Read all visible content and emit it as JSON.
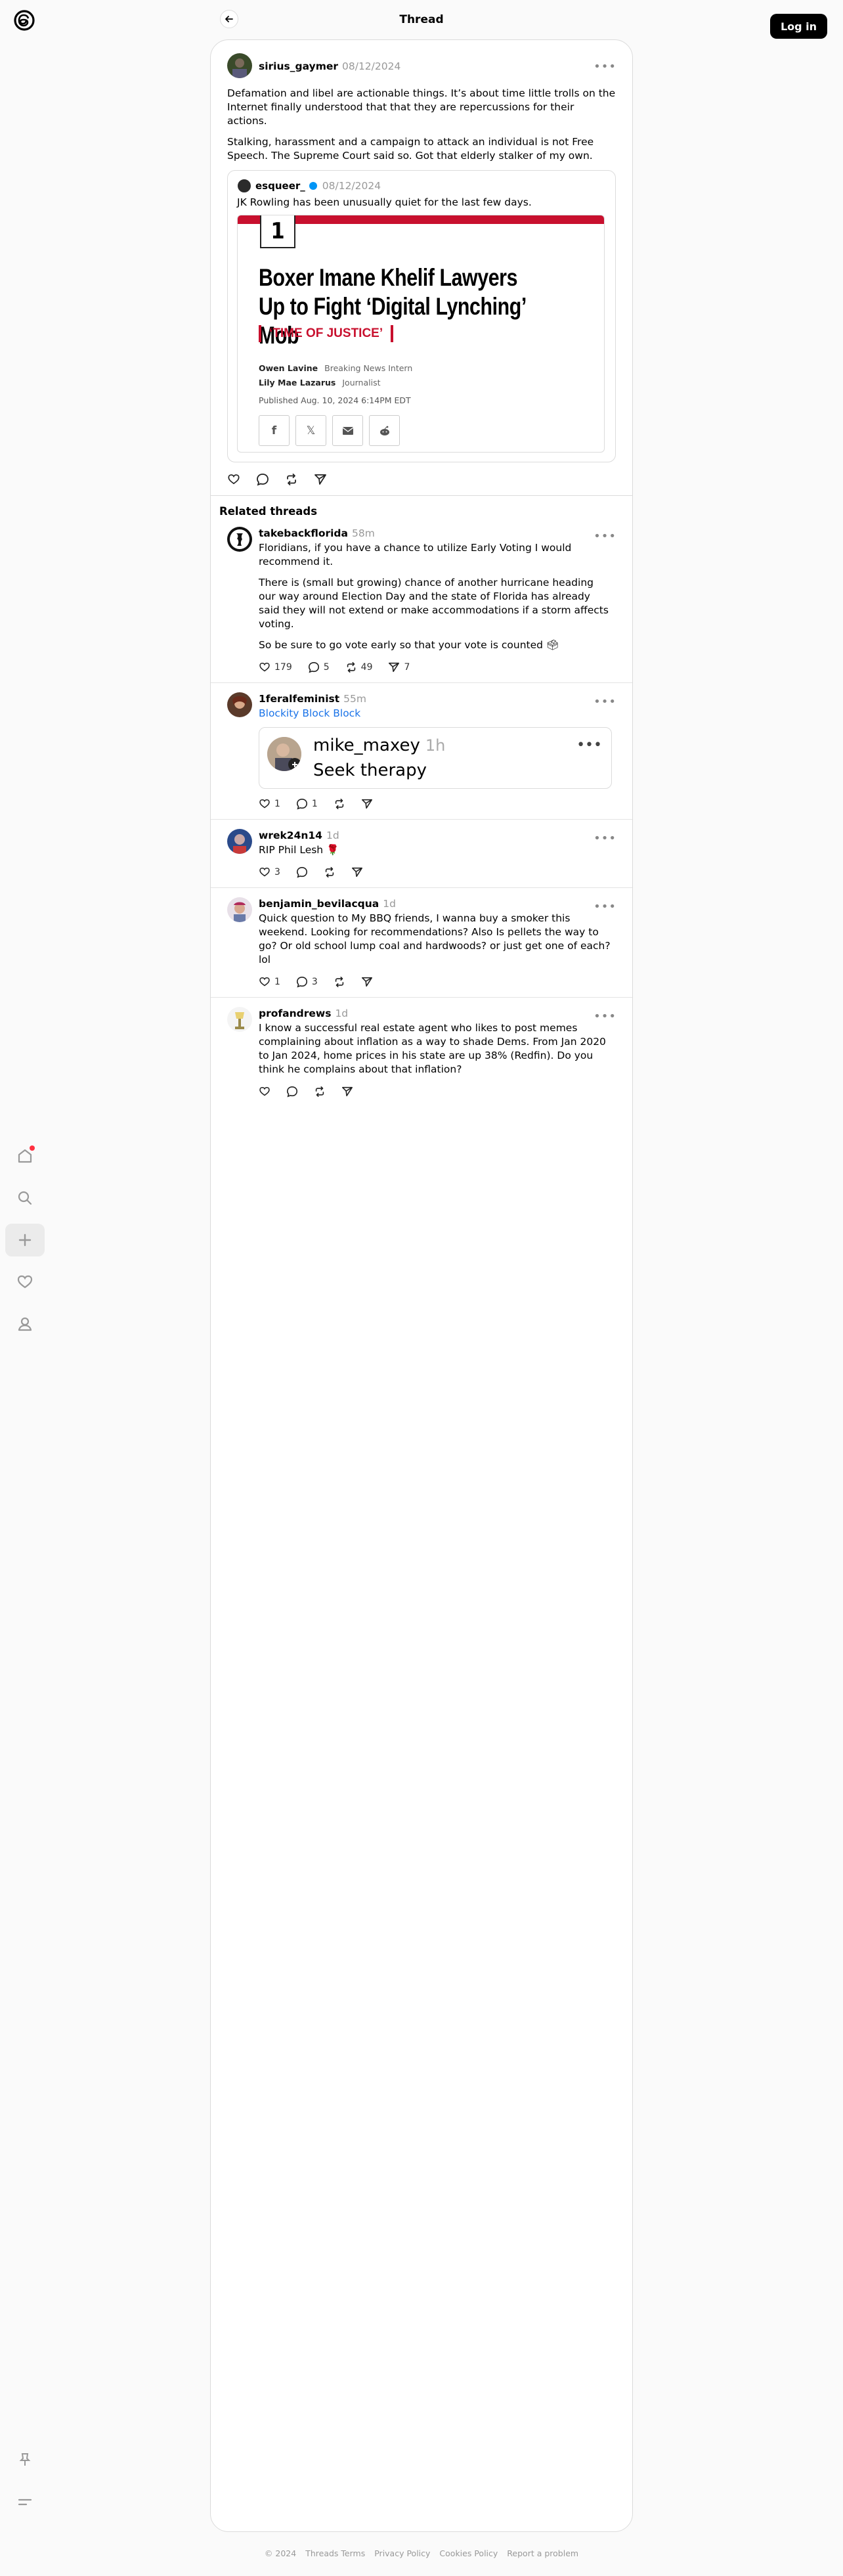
{
  "header": {
    "title": "Thread",
    "login_label": "Log in"
  },
  "post": {
    "username": "sirius_gaymer",
    "time": "08/12/2024",
    "paragraphs": [
      "Defamation and libel are actionable things. It’s about time little trolls on the Internet finally understood that that they are repercussions for their actions.",
      "Stalking, harassment and a campaign to attack an individual is not Free Speech. The Supreme Court said so. Got that elderly stalker of my own."
    ],
    "quote": {
      "username": "esqueer_",
      "time": "08/12/2024",
      "text": "JK Rowling has been unusually quiet for the last few days.",
      "article": {
        "number": "1",
        "headline": "Boxer Imane Khelif Lawyers Up to Fight ‘Digital Lynching’ Mob",
        "kicker": "‘TIME OF JUSTICE’",
        "authors": [
          {
            "name": "Owen Lavine",
            "role": "Breaking News Intern"
          },
          {
            "name": "Lily Mae Lazarus",
            "role": "Journalist"
          }
        ],
        "published": "Published Aug. 10, 2024 6:14PM EDT",
        "share_icons": [
          "facebook-icon",
          "x-icon",
          "email-icon",
          "reddit-icon"
        ]
      }
    }
  },
  "related": {
    "title": "Related threads",
    "items": [
      {
        "username": "takebackflorida",
        "time": "58m",
        "paragraphs": [
          "Floridians, if you have a chance to utilize Early Voting I would recommend it.",
          "There is (small but growing) chance of another hurricane heading our way around Election Day and the state of Florida has already said they will not extend or make accommodations if a storm affects voting.",
          "So be sure to go vote early so that your vote is counted 🗳"
        ],
        "likes": "179",
        "replies": "5",
        "reposts": "49",
        "shares": "7"
      },
      {
        "username": "1feralfeminist",
        "time": "55m",
        "link_text": "Blockity Block Block",
        "embed": {
          "username": "mike_maxey",
          "time": "1h",
          "text": "Seek therapy"
        },
        "likes": "1",
        "replies": "1",
        "reposts": "",
        "shares": ""
      },
      {
        "username": "wrek24n14",
        "time": "1d",
        "paragraphs": [
          "RIP Phil Lesh 🌹"
        ],
        "likes": "3",
        "replies": "",
        "reposts": "",
        "shares": ""
      },
      {
        "username": "benjamin_bevilacqua",
        "time": "1d",
        "paragraphs": [
          "Quick question to My BBQ friends, I wanna buy a smoker this weekend. Looking for recommendations? Also Is pellets the way to go? Or old school lump coal and hardwoods? or just get one of each? lol"
        ],
        "likes": "1",
        "replies": "3",
        "reposts": "",
        "shares": ""
      },
      {
        "username": "profandrews",
        "time": "1d",
        "paragraphs": [
          "I know a successful real estate agent who likes to post memes complaining about inflation as a way to shade Dems. From Jan 2020 to Jan 2024, home prices in his state are up 38% (Redfin). Do you think he complains about that inflation?"
        ],
        "likes": "",
        "replies": "",
        "reposts": "",
        "shares": ""
      }
    ]
  },
  "footer": {
    "links": [
      "© 2024",
      "Threads Terms",
      "Privacy Policy",
      "Cookies Policy",
      "Report a problem"
    ]
  },
  "colors": {
    "accent_red": "#c8102e",
    "link_blue": "#1a73e8",
    "notification": "#ff3040"
  }
}
